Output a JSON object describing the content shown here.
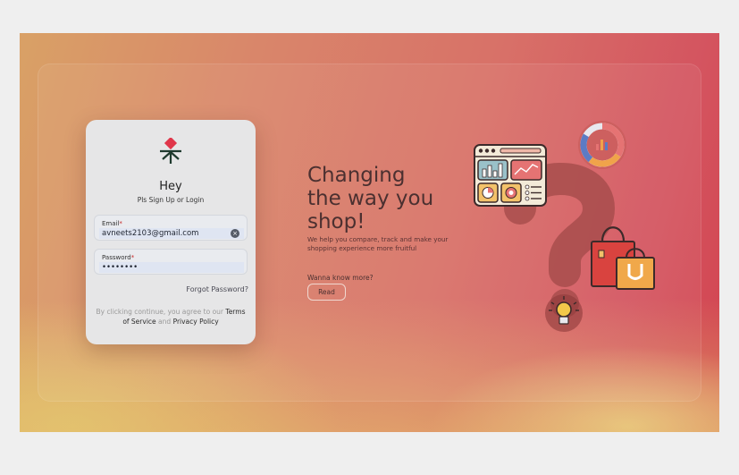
{
  "login": {
    "title": "Hey",
    "subtitle": "Pls Sign Up or Login",
    "email_label": "Email",
    "email_value": "avneets2103@gmail.com",
    "password_label": "Password",
    "password_value": "••••••••",
    "required_marker": "*",
    "forgot_password": "Forgot Password?",
    "terms_prefix": "By clicking continue, you agree to our",
    "terms_link": "Terms of Service",
    "terms_and": "and",
    "privacy_link": "Privacy Policy"
  },
  "hero": {
    "title_line1": "Changing",
    "title_line2": "the way you",
    "title_line3": "shop!",
    "subtitle": "We help you compare, track and make your shopping experience more fruitful",
    "more_label": "Wanna know more?",
    "read_button": "Read"
  },
  "icons": {
    "logo": "leaf-diamond-logo-icon",
    "clear": "clear-circle-x-icon",
    "dashboard": "dashboard-window-icon",
    "donut_chart": "donut-chart-icon",
    "question_mark": "question-mark-icon",
    "shopping_bags": "shopping-bags-icon",
    "idea_bulb": "idea-bulb-icon"
  },
  "colors": {
    "accent_red": "#e0364a",
    "logo_dark": "#1f3a2e",
    "card_bg": "#e6e6e7",
    "background_start": "#d9a166",
    "background_end": "#d2434f"
  }
}
